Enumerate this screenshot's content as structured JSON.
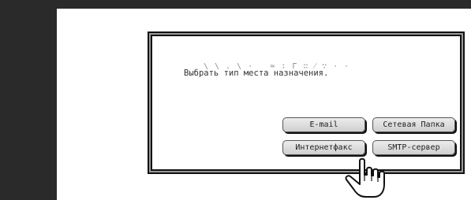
{
  "dialog": {
    "prompt": "Выбрать тип места назначения.",
    "buttons": {
      "email": "E-mail",
      "network_folder": "Сетевая Папка",
      "internet_fax": "Интернетфакс",
      "smtp_server": "SMTP-сервер"
    }
  },
  "colors": {
    "frame": "#2a2a2a",
    "dialog_border": "#111111",
    "button_face": "#dcdcdc"
  },
  "icons": {
    "pointer": "hand-pointer-icon"
  }
}
